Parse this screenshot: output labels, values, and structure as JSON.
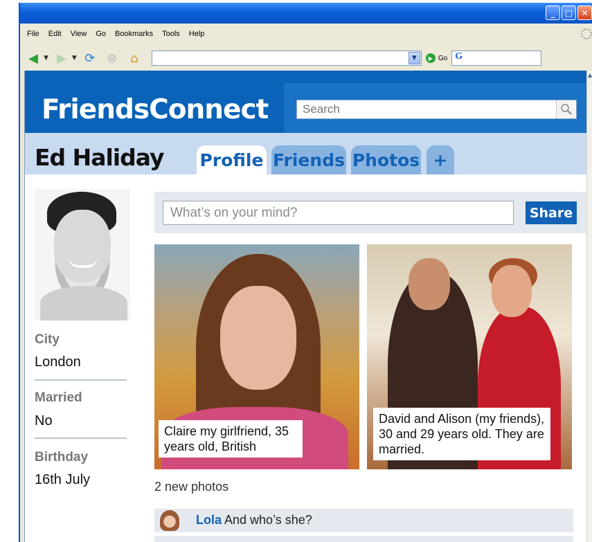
{
  "browser": {
    "menu": [
      "File",
      "Edit",
      "View",
      "Go",
      "Bookmarks",
      "Tools",
      "Help"
    ],
    "go_label": "Go",
    "address": ""
  },
  "site": {
    "logo": "FriendsConnect",
    "search_placeholder": "Search"
  },
  "profile": {
    "name": "Ed Haliday",
    "tabs": [
      "Profile",
      "Friends",
      "Photos",
      "+"
    ],
    "active_tab": "Profile",
    "info": [
      {
        "label": "City",
        "value": "London"
      },
      {
        "label": "Married",
        "value": "No"
      },
      {
        "label": "Birthday",
        "value": "16th July"
      }
    ]
  },
  "status": {
    "placeholder": "What’s on your mind?",
    "share_label": "Share"
  },
  "photos": [
    {
      "caption": "Claire my girlfriend, 35 years old, British"
    },
    {
      "caption": "David and Alison (my friends), 30 and 29 years old. They are married."
    }
  ],
  "new_photos_text": "2 new photos",
  "comments": [
    {
      "author": "Lola",
      "text": " And who’s she?"
    }
  ],
  "colors": {
    "brand_blue": "#0a63b8",
    "tab_text": "#1262b5",
    "name_bar": "#c8daf0"
  }
}
